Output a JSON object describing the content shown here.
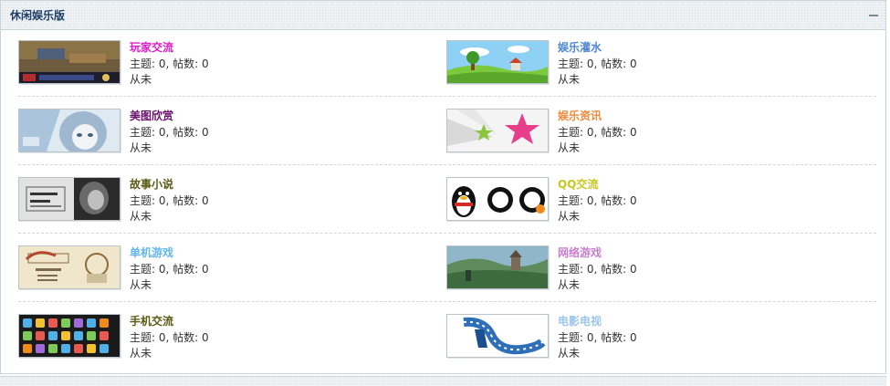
{
  "panel": {
    "title": "休闲娱乐版",
    "collapse_icon": "minus-icon"
  },
  "stats_template": {
    "topics_label": "主题",
    "posts_label": "帖数"
  },
  "forums": [
    {
      "name": "玩家交流",
      "color": "#e21bc8",
      "topics": 0,
      "posts": 0,
      "stats": "主题: 0, 帖数: 0",
      "last_post": "从未",
      "thumbnail": "game-screenshot-thumbnail"
    },
    {
      "name": "娱乐灌水",
      "color": "#4f87d6",
      "topics": 0,
      "posts": 0,
      "stats": "主题: 0, 帖数: 0",
      "last_post": "从未",
      "thumbnail": "meadow-landscape-thumbnail"
    },
    {
      "name": "美图欣赏",
      "color": "#6b0f6b",
      "topics": 0,
      "posts": 0,
      "stats": "主题: 0, 帖数: 0",
      "last_post": "从未",
      "thumbnail": "anime-girl-thumbnail"
    },
    {
      "name": "娱乐资讯",
      "color": "#f0893c",
      "topics": 0,
      "posts": 0,
      "stats": "主题: 0, 帖数: 0",
      "last_post": "从未",
      "thumbnail": "stars-thumbnail"
    },
    {
      "name": "故事小说",
      "color": "#5a5a14",
      "topics": 0,
      "posts": 0,
      "stats": "主题: 0, 帖数: 0",
      "last_post": "从未",
      "thumbnail": "story-thumbnail"
    },
    {
      "name": "QQ交流",
      "color": "#c9c61f",
      "topics": 0,
      "posts": 0,
      "stats": "主题: 0, 帖数: 0",
      "last_post": "从未",
      "thumbnail": "qq-penguin-thumbnail"
    },
    {
      "name": "单机游戏",
      "color": "#62b6ea",
      "topics": 0,
      "posts": 0,
      "stats": "主题: 0, 帖数: 0",
      "last_post": "从未",
      "thumbnail": "contra-game-thumbnail"
    },
    {
      "name": "网络游戏",
      "color": "#c77fcf",
      "topics": 0,
      "posts": 0,
      "stats": "主题: 0, 帖数: 0",
      "last_post": "从未",
      "thumbnail": "online-game-thumbnail"
    },
    {
      "name": "手机交流",
      "color": "#5a5a14",
      "topics": 0,
      "posts": 0,
      "stats": "主题: 0, 帖数: 0",
      "last_post": "从未",
      "thumbnail": "phone-apps-thumbnail"
    },
    {
      "name": "电影电视",
      "color": "#9cc6ea",
      "topics": 0,
      "posts": 0,
      "stats": "主题: 0, 帖数: 0",
      "last_post": "从未",
      "thumbnail": "film-strip-thumbnail"
    }
  ]
}
